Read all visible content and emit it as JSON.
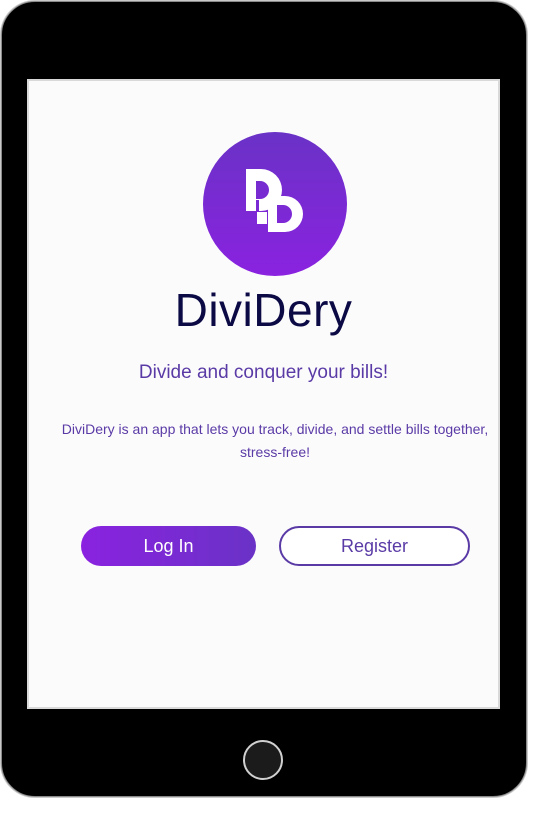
{
  "app": {
    "name": "DiviDery",
    "tagline": "Divide and conquer your bills!",
    "description": "DiviDery is an app that lets you track, divide, and settle bills together, stress-free!"
  },
  "logo": {
    "icon": "dividery-logo-icon",
    "gradient_start": "#6a32c6",
    "gradient_end": "#8a22e0"
  },
  "actions": {
    "login_label": "Log In",
    "register_label": "Register"
  },
  "colors": {
    "title": "#0b0a45",
    "accent": "#5a3ba6",
    "button_gradient_start": "#8a22e0",
    "button_gradient_end": "#6a32c6",
    "device_frame": "#000000",
    "screen_background": "#fcfbfc"
  }
}
